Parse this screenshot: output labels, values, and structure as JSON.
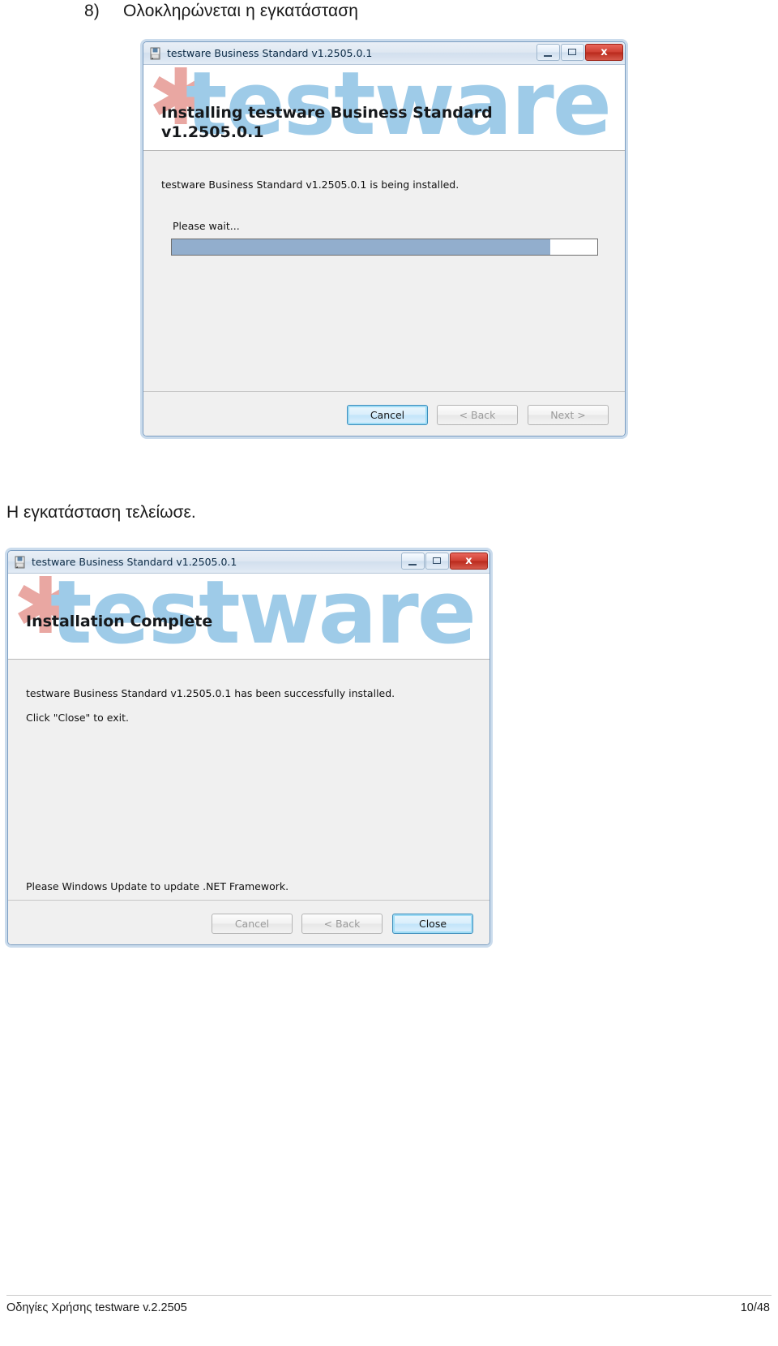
{
  "document": {
    "heading_number": "8)",
    "heading_text": "Ολοκληρώνεται η εγκατάσταση",
    "mid_caption": "Η εγκατάσταση τελείωσε.",
    "footer_left": "Οδηγίες Χρήσης testware v.2.2505",
    "footer_page": "10/48"
  },
  "dialog_installing": {
    "titlebar": {
      "title": "testware Business Standard v1.2505.0.1",
      "icon": "installer-package-icon",
      "minimize_label": "",
      "maximize_label": "",
      "close_label": "x"
    },
    "banner": {
      "heading_line1": "Installing testware Business Standard",
      "heading_line2": "v1.2505.0.1",
      "watermark_text": "testware",
      "watermark_star": "✱"
    },
    "body": {
      "status_line": "testware Business Standard v1.2505.0.1 is being installed.",
      "wait_line": "Please wait...",
      "progress_percent": 89
    },
    "buttons": [
      {
        "label": "Cancel",
        "state": "focused",
        "name": "cancel-button"
      },
      {
        "label": "< Back",
        "state": "disabled",
        "name": "back-button"
      },
      {
        "label": "Next >",
        "state": "disabled",
        "name": "next-button"
      }
    ]
  },
  "dialog_complete": {
    "titlebar": {
      "title": "testware Business Standard v1.2505.0.1",
      "icon": "installer-package-icon",
      "minimize_label": "",
      "maximize_label": "",
      "close_label": "x"
    },
    "banner": {
      "heading_line1": "Installation Complete",
      "heading_line2": "",
      "watermark_text": "testware",
      "watermark_star": "✱"
    },
    "body": {
      "status_line": "testware Business Standard v1.2505.0.1 has been successfully installed.",
      "instruction_line": "Click \"Close\" to exit.",
      "note_line": "Please Windows Update to update .NET Framework."
    },
    "buttons": [
      {
        "label": "Cancel",
        "state": "disabled",
        "name": "cancel-button"
      },
      {
        "label": "< Back",
        "state": "disabled",
        "name": "back-button"
      },
      {
        "label": "Close",
        "state": "focused",
        "name": "close-button"
      }
    ]
  },
  "colors": {
    "accent_blue": "#3c8dbc",
    "progress_fill": "#92aecd",
    "watermark_blue": "#9ecbe8",
    "watermark_red": "#e9a7a2",
    "close_red": "#cf4033"
  }
}
